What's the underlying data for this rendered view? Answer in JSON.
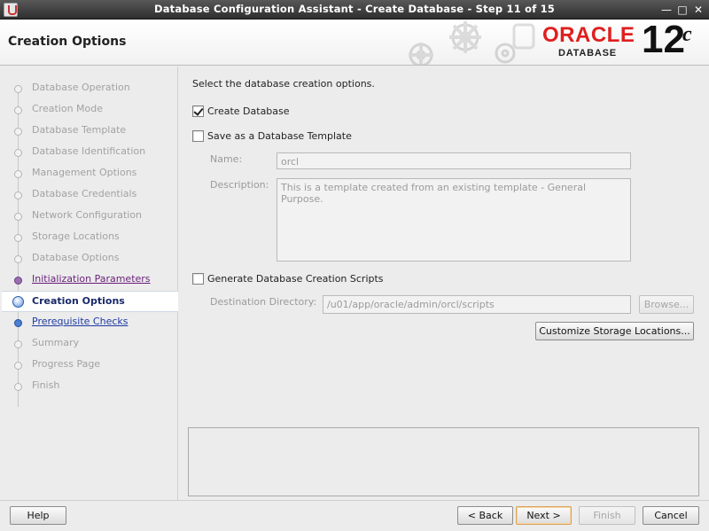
{
  "window": {
    "title": "Database Configuration Assistant - Create Database - Step 11 of 15",
    "controls": [
      "—",
      "□",
      "✕"
    ]
  },
  "header": {
    "page_title": "Creation Options",
    "logo": {
      "brand": "ORACLE",
      "product": "DATABASE",
      "version": "12",
      "version_suffix": "c",
      "brand_color": "#e01e1e"
    }
  },
  "nav": {
    "items": [
      {
        "label": "Database Operation",
        "state": "done"
      },
      {
        "label": "Creation Mode",
        "state": "done"
      },
      {
        "label": "Database Template",
        "state": "done"
      },
      {
        "label": "Database Identification",
        "state": "done"
      },
      {
        "label": "Management Options",
        "state": "done"
      },
      {
        "label": "Database Credentials",
        "state": "done"
      },
      {
        "label": "Network Configuration",
        "state": "done"
      },
      {
        "label": "Storage Locations",
        "state": "done"
      },
      {
        "label": "Database Options",
        "state": "done"
      },
      {
        "label": "Initialization Parameters",
        "state": "visited-link"
      },
      {
        "label": "Creation Options",
        "state": "current"
      },
      {
        "label": "Prerequisite Checks",
        "state": "next-link"
      },
      {
        "label": "Summary",
        "state": "pending"
      },
      {
        "label": "Progress Page",
        "state": "pending"
      },
      {
        "label": "Finish",
        "state": "pending"
      }
    ]
  },
  "main": {
    "intro": "Select the database creation options.",
    "create_database": {
      "label": "Create Database",
      "checked": true
    },
    "save_template": {
      "label": "Save as a Database Template",
      "checked": false
    },
    "name": {
      "label": "Name:",
      "value": "orcl"
    },
    "description": {
      "label": "Description:",
      "value": "This is a template created from an existing template - General Purpose."
    },
    "generate_scripts": {
      "label": "Generate Database Creation Scripts",
      "checked": false
    },
    "destination": {
      "label": "Destination Directory:",
      "value": "/u01/app/oracle/admin/orcl/scripts",
      "browse": "Browse..."
    },
    "customize_storage": "Customize Storage Locations..."
  },
  "footer": {
    "help": "Help",
    "back": "< Back",
    "next": "Next >",
    "finish": "Finish",
    "cancel": "Cancel"
  }
}
